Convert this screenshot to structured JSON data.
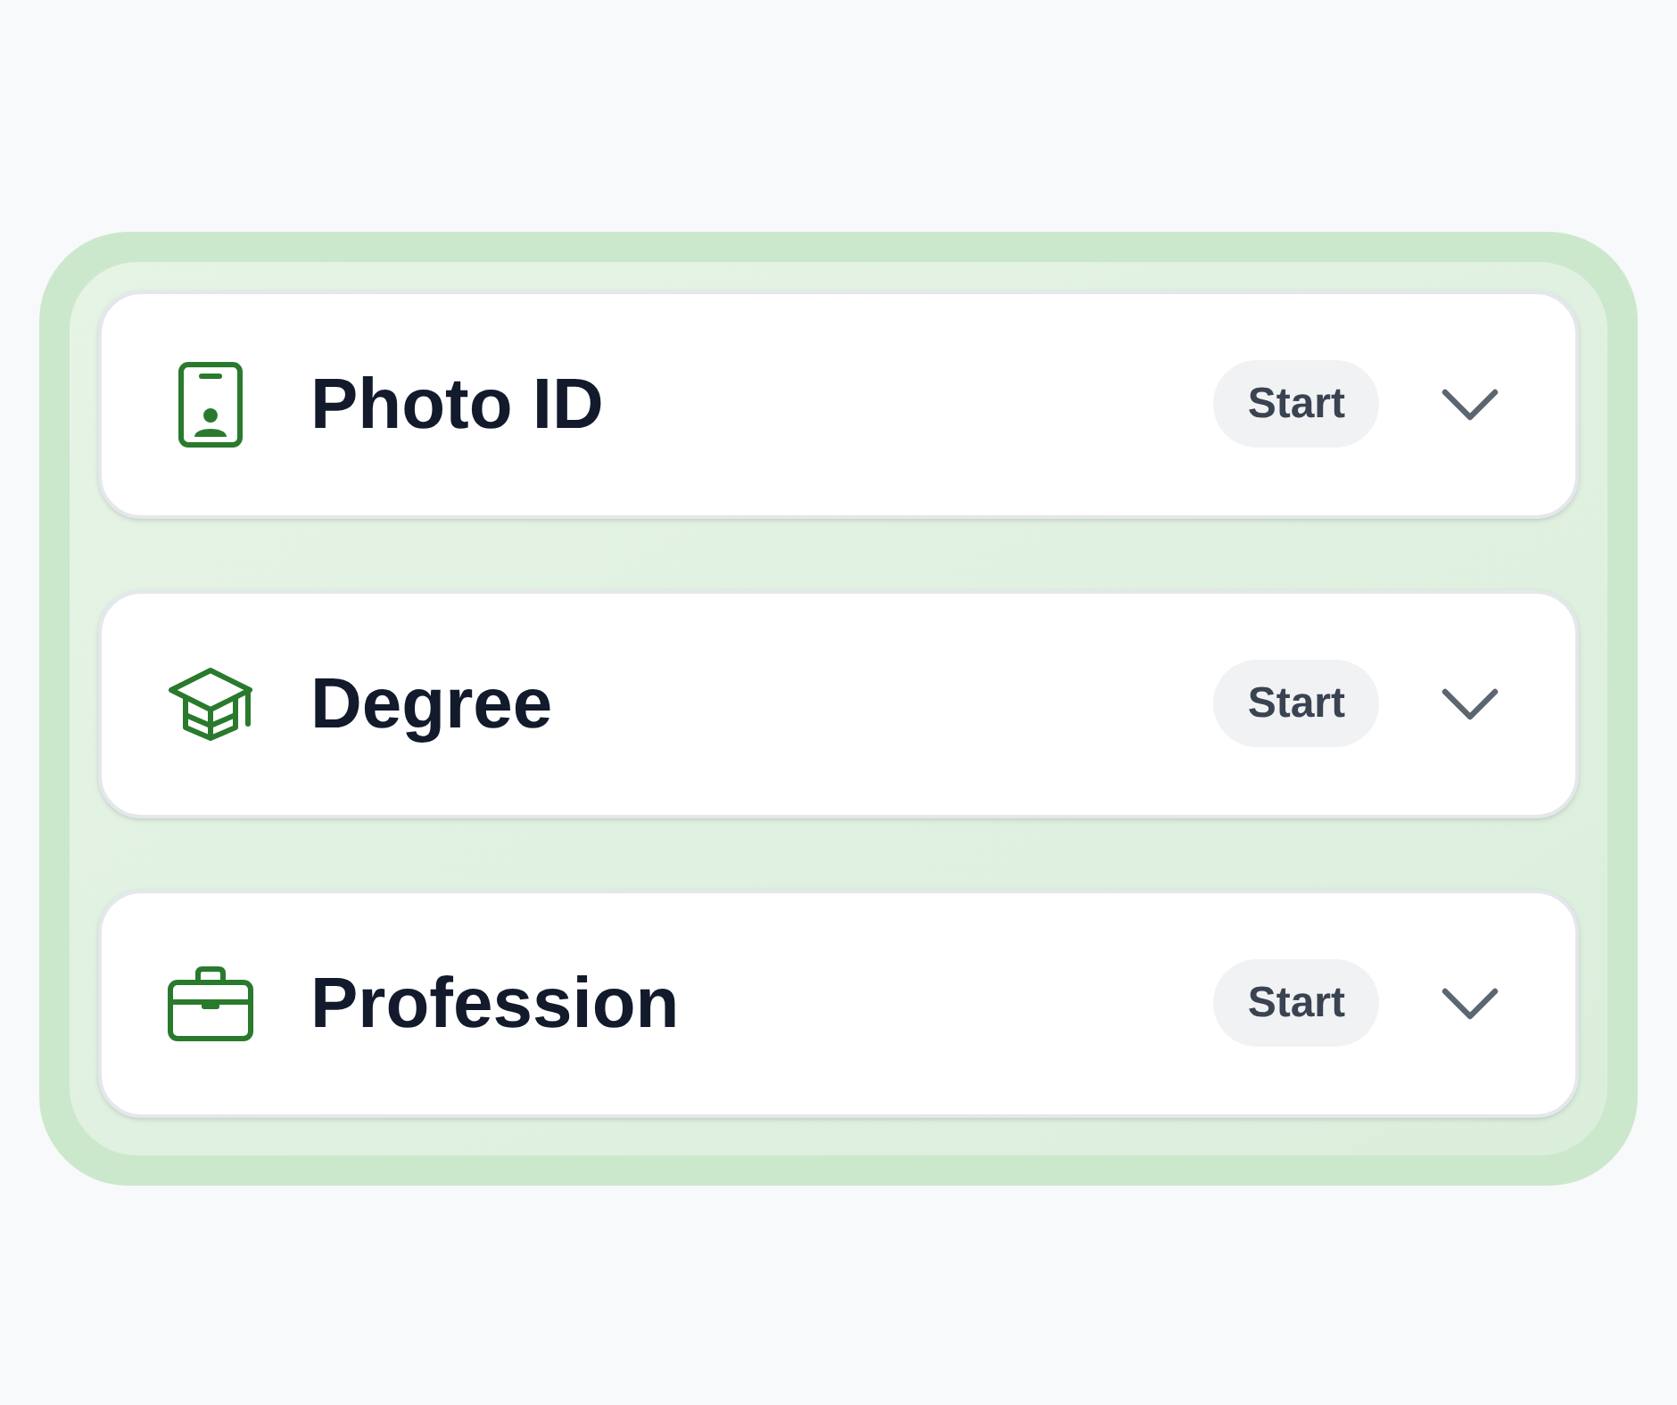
{
  "items": [
    {
      "kind": "photo-id",
      "title": "Photo ID",
      "action": "Start",
      "expanded": false
    },
    {
      "kind": "degree",
      "title": "Degree",
      "action": "Start",
      "expanded": false
    },
    {
      "kind": "profession",
      "title": "Profession",
      "action": "Start",
      "expanded": false
    }
  ]
}
